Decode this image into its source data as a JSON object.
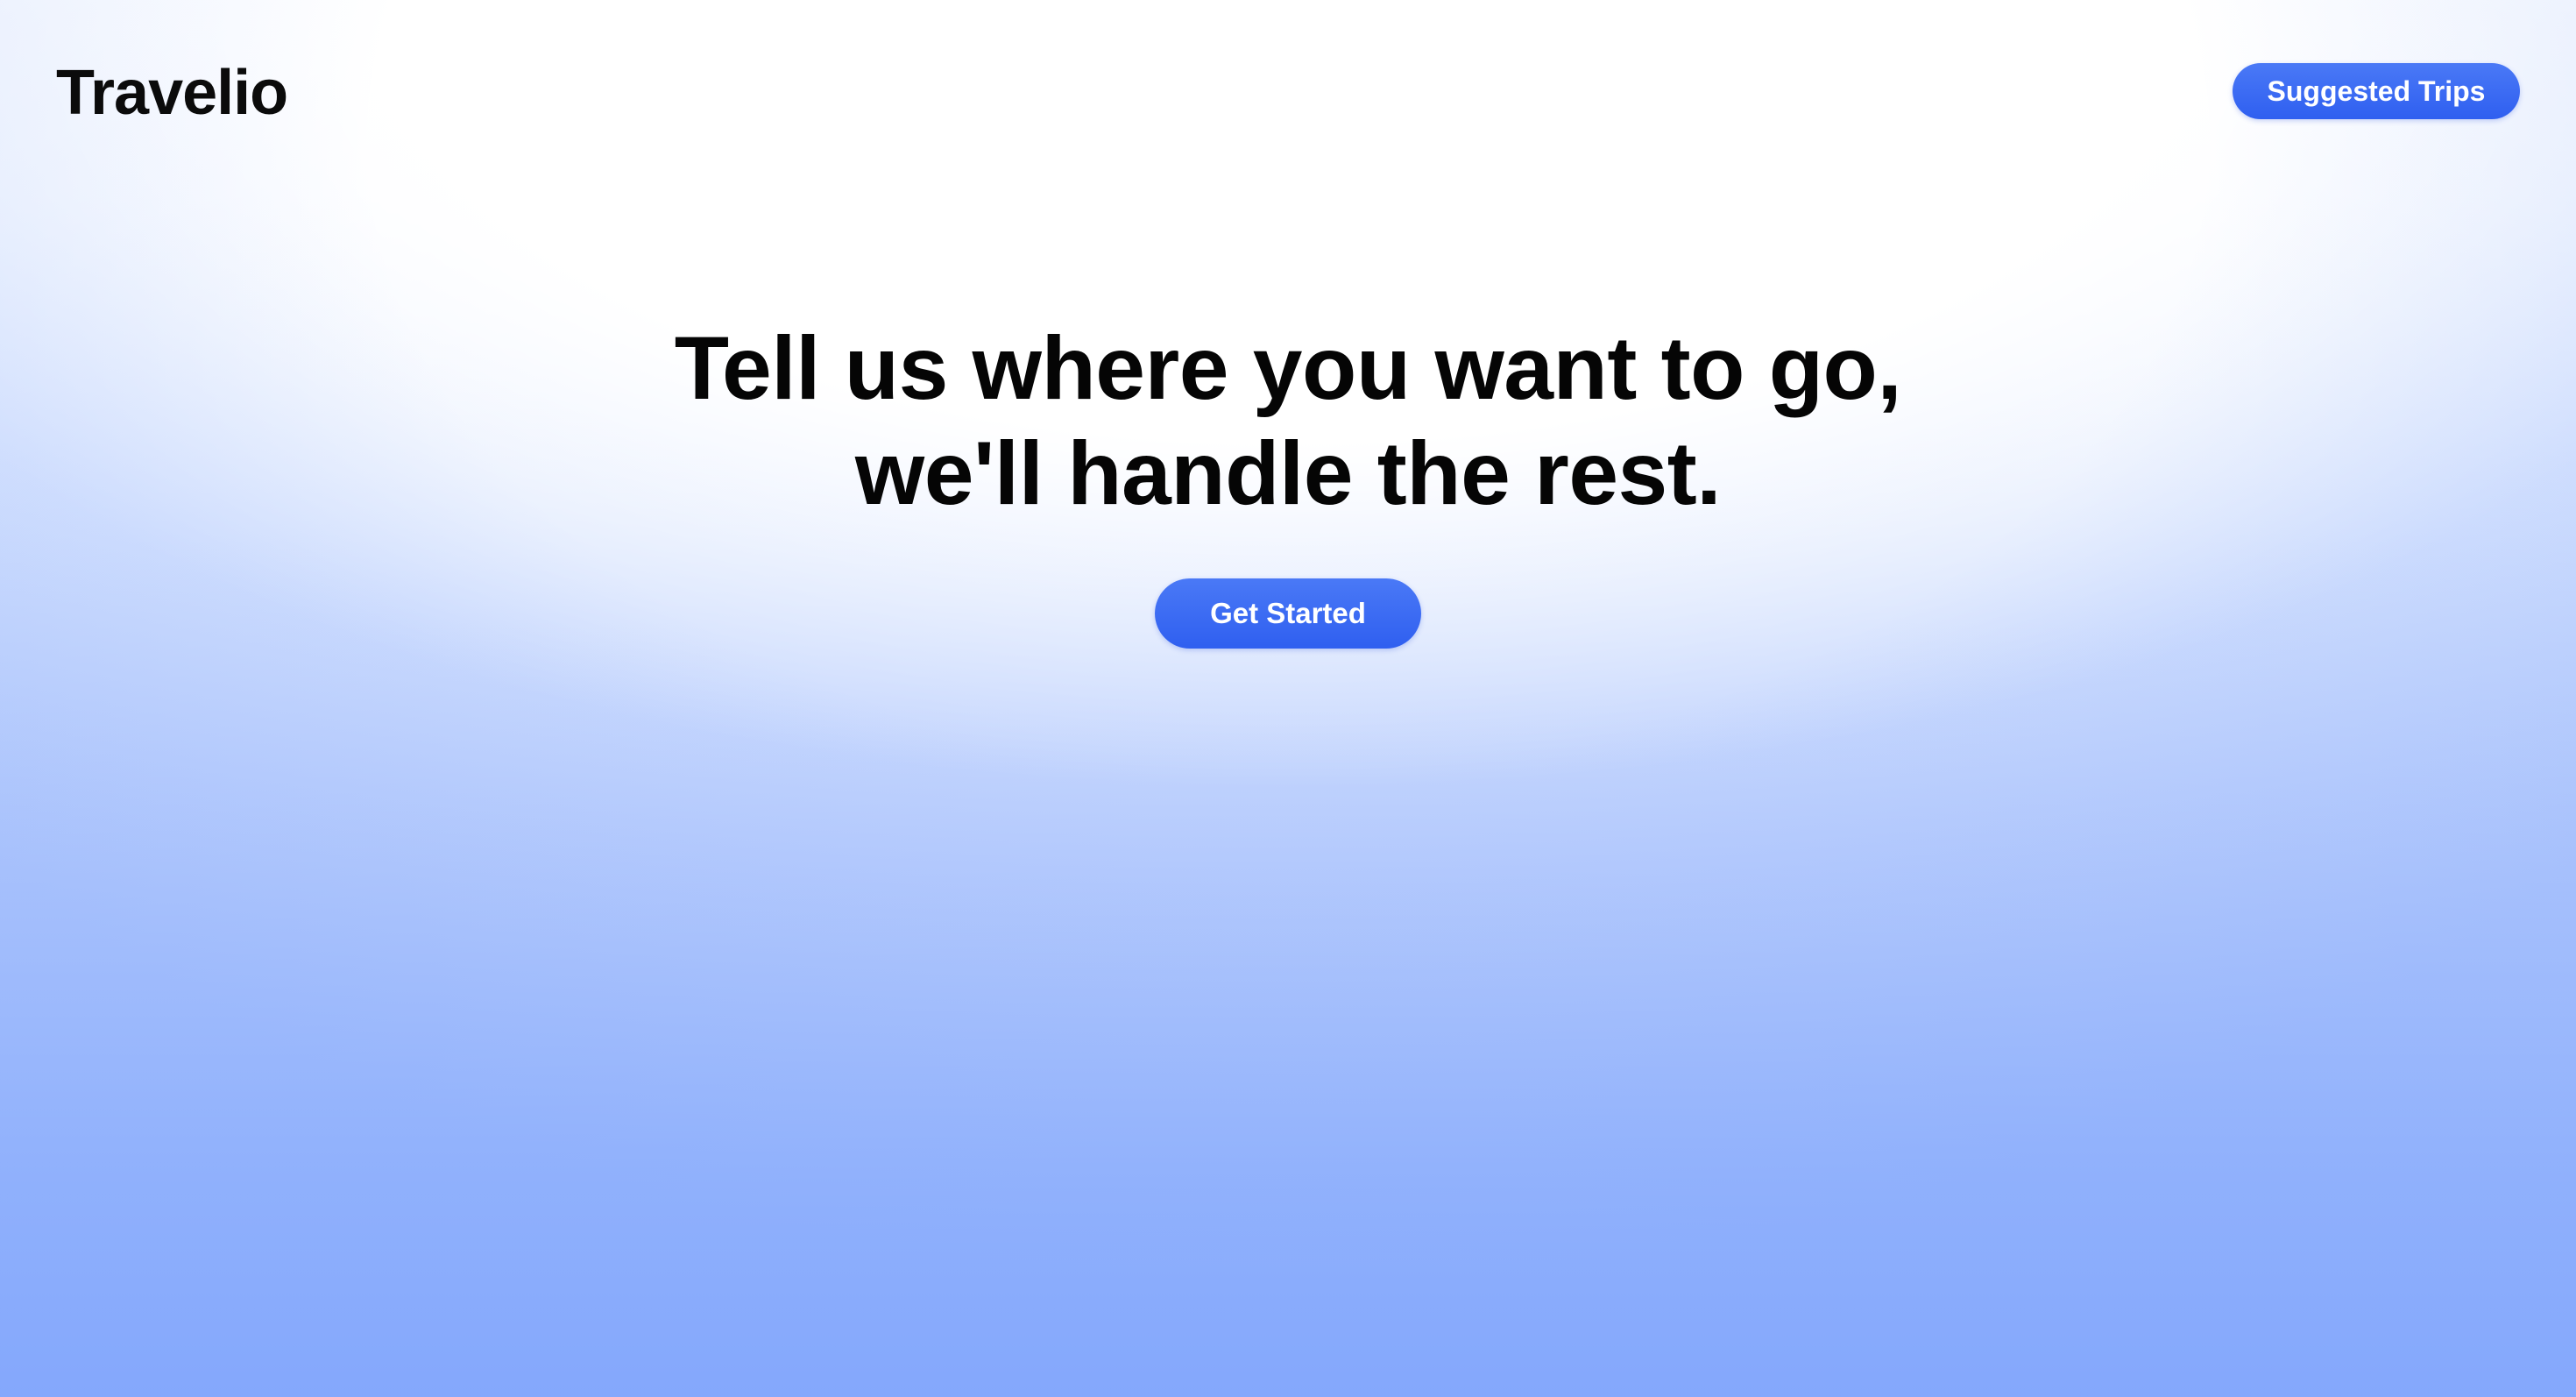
{
  "brand": {
    "name": "Travelio"
  },
  "nav": {
    "suggested_trips_label": "Suggested Trips"
  },
  "hero": {
    "title_line_1": "Tell us where you want to go,",
    "title_line_2": "we'll handle the rest.",
    "cta_label": "Get Started"
  },
  "colors": {
    "accent": "#3565F2",
    "text": "#050505",
    "background_top": "#FFFFFF",
    "background_bottom": "#88AAFC"
  }
}
